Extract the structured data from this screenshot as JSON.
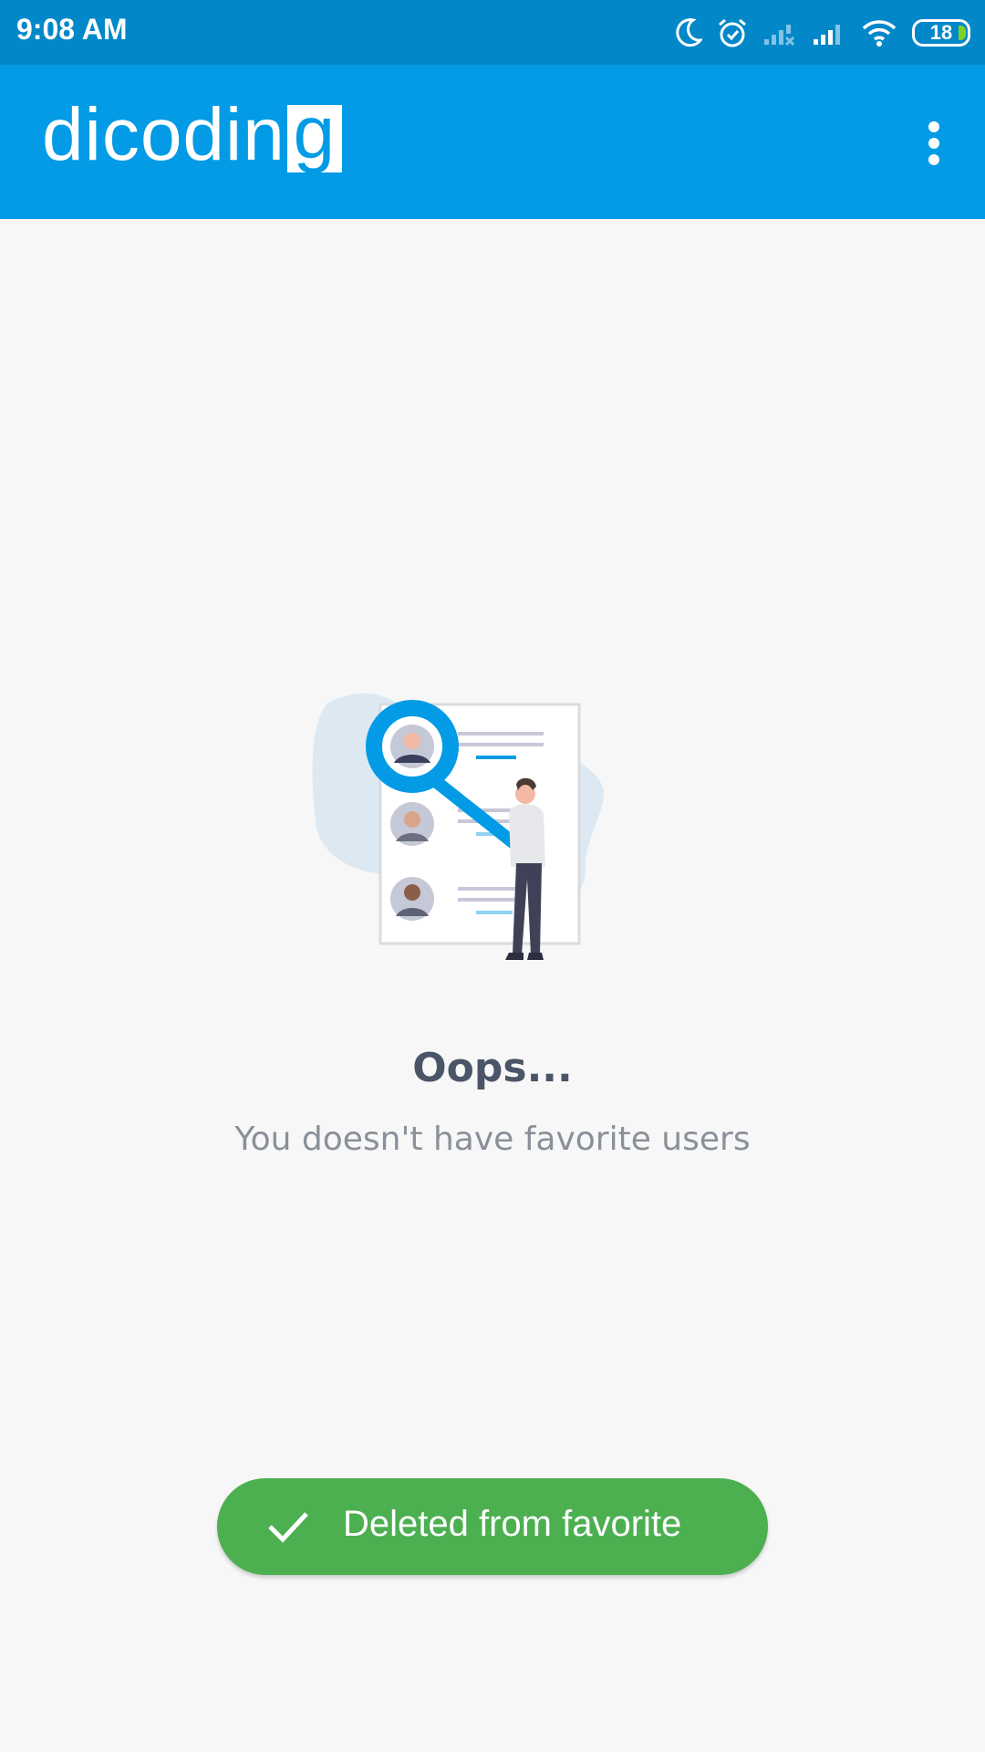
{
  "status_bar": {
    "time": "9:08 AM",
    "battery_level": "18",
    "icons": [
      "moon-icon",
      "alarm-icon",
      "signal-no-service-icon",
      "signal-icon",
      "wifi-icon",
      "battery-icon"
    ]
  },
  "app_bar": {
    "logo_text": "dicodin",
    "logo_box_letter": "g",
    "menu_icon": "more-vert-icon",
    "background_color": "#039be5"
  },
  "empty_state": {
    "title": "Oops...",
    "message": "You doesn't have favorite users",
    "illustration": "search-users-illustration"
  },
  "toast": {
    "icon": "check-icon",
    "message": "Deleted from favorite",
    "color": "#4caf50"
  }
}
